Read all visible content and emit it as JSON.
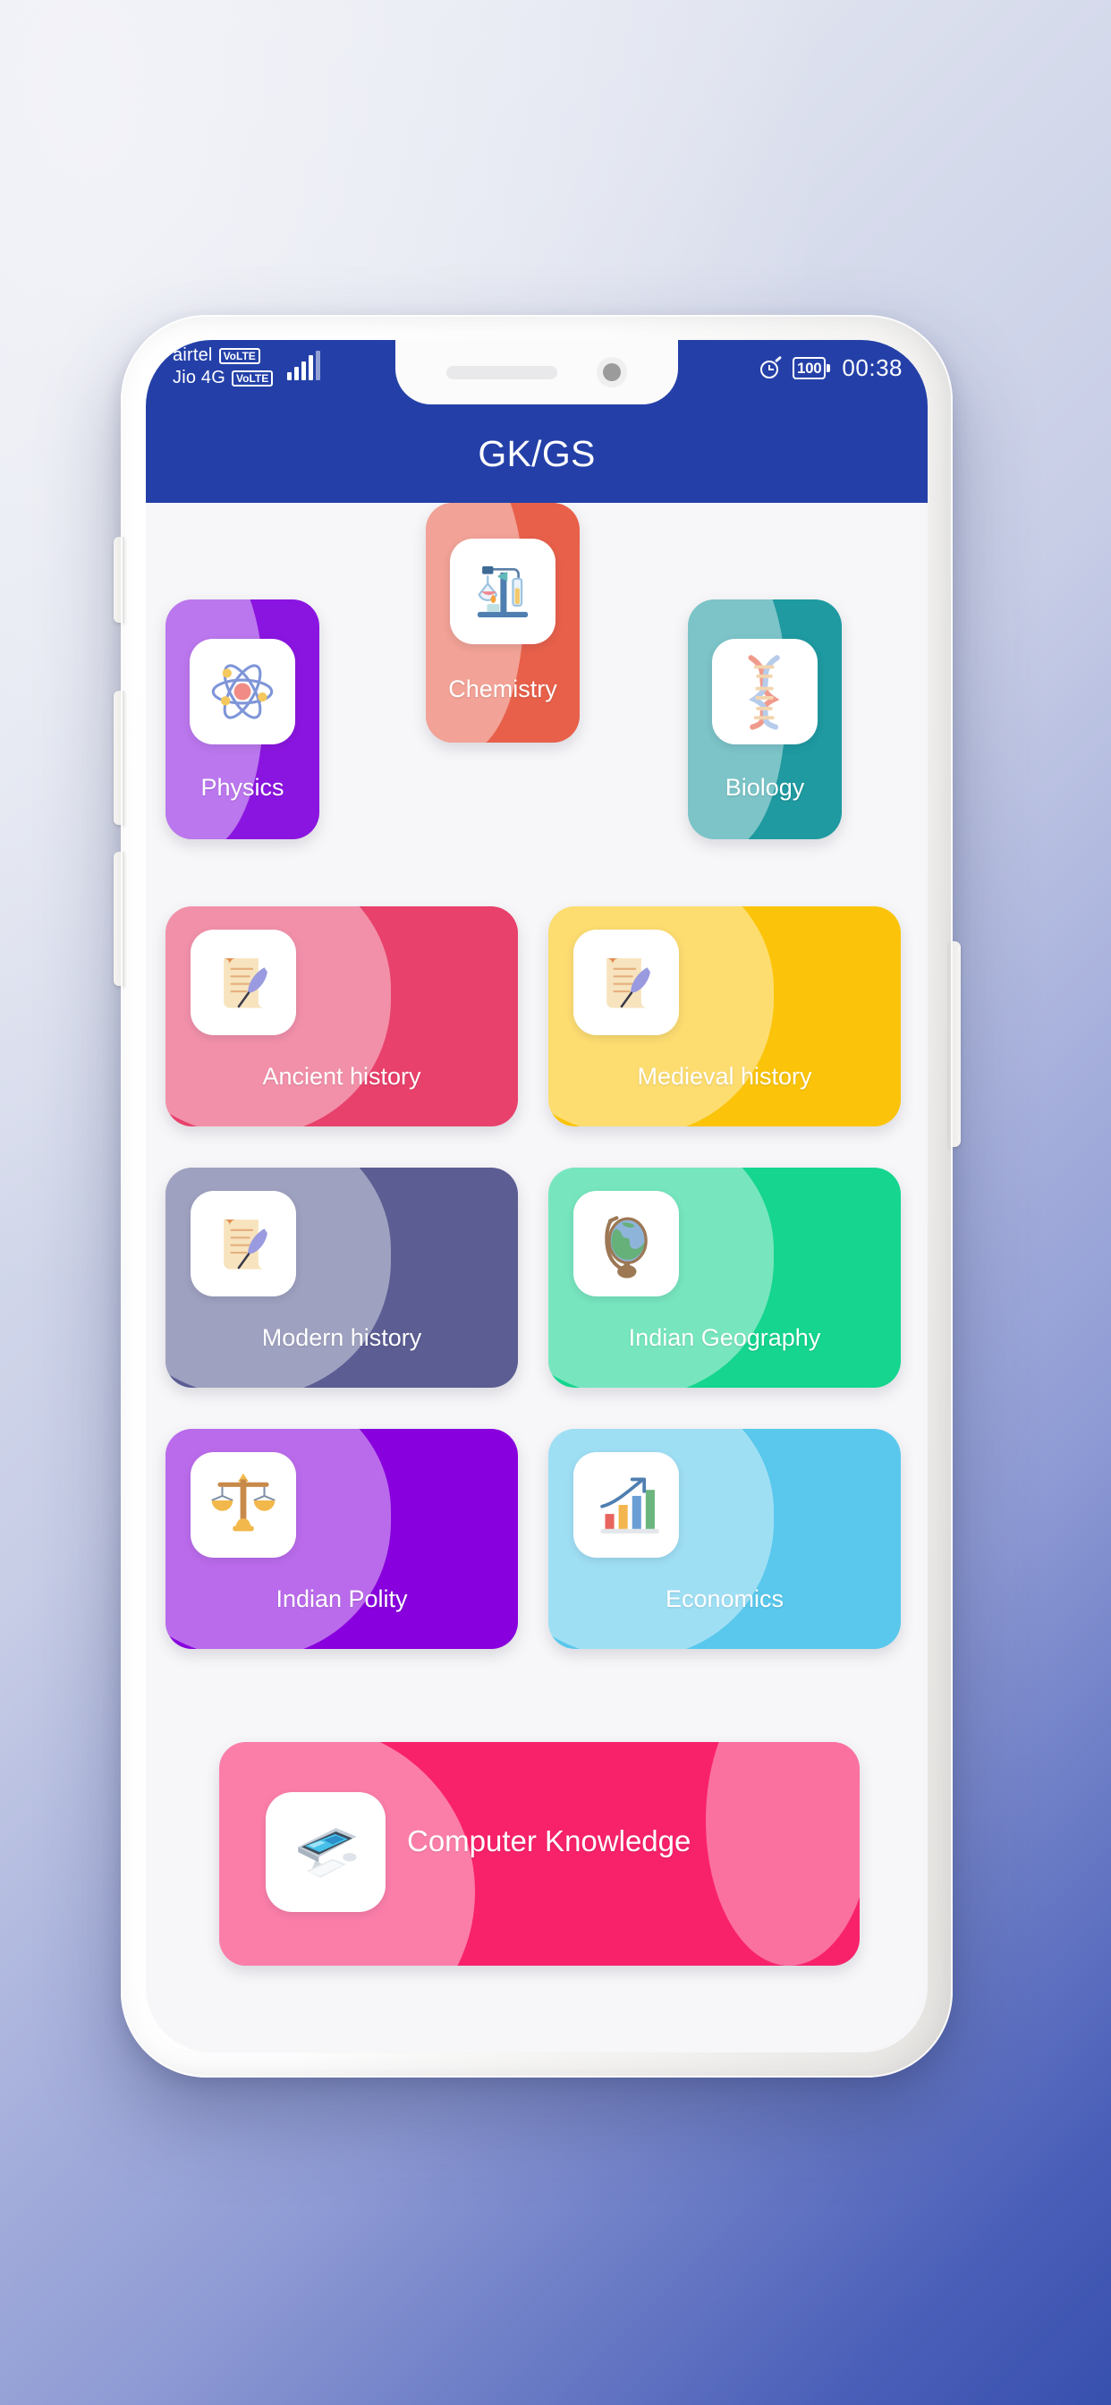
{
  "status_bar": {
    "carrier_primary": "airtel",
    "carrier_primary_badge": "VoLTE",
    "carrier_secondary": "Jio 4G",
    "carrier_secondary_badge": "VoLTE",
    "signal_icon": "signal-bars-icon",
    "alarm_icon": "alarm-clock-icon",
    "battery_level": "100",
    "battery_icon": "battery-icon",
    "time": "00:38"
  },
  "app_bar": {
    "title": "GK/GS",
    "color": "#2440a8"
  },
  "notch": {
    "speaker_icon": "speaker-grille-icon",
    "camera_icon": "front-camera-icon"
  },
  "tiles": [
    {
      "id": "physics",
      "label": "Physics",
      "icon": "atom-icon",
      "color": "#8b15e0",
      "blob_color": "#b45ef0"
    },
    {
      "id": "chemistry",
      "label": "Chemistry",
      "icon": "lab-flask-icon",
      "color": "#e8604a",
      "blob_color": "#f2917e"
    },
    {
      "id": "biology",
      "label": "Biology",
      "icon": "dna-icon",
      "color": "#1e9aa0",
      "blob_color": "#6ebfc2"
    },
    {
      "id": "ancient-history",
      "label": "Ancient history",
      "icon": "scroll-quill-icon",
      "color": "#e8416b",
      "blob_color": "#f28fa8"
    },
    {
      "id": "medieval-history",
      "label": "Medieval history",
      "icon": "scroll-quill-icon",
      "color": "#fbc40a",
      "blob_color": "#fcd85e"
    },
    {
      "id": "modern-history",
      "label": "Modern history",
      "icon": "scroll-quill-icon",
      "color": "#5b5d93",
      "blob_color": "#9092b4"
    },
    {
      "id": "indian-geography",
      "label": "Indian Geography",
      "icon": "globe-icon",
      "color": "#15d58f",
      "blob_color": "#6ee3b8"
    },
    {
      "id": "indian-polity",
      "label": "Indian Polity",
      "icon": "scales-icon",
      "color": "#8800dd",
      "blob_color": "#b763ef"
    },
    {
      "id": "economics",
      "label": "Economics",
      "icon": "bar-chart-icon",
      "color": "#5ac8ed",
      "blob_color": "#9adef5"
    },
    {
      "id": "computer",
      "label": "Computer Knowledge",
      "icon": "desktop-pc-icon",
      "color": "#f8226b",
      "blob_color": "#fb7fa7"
    }
  ]
}
